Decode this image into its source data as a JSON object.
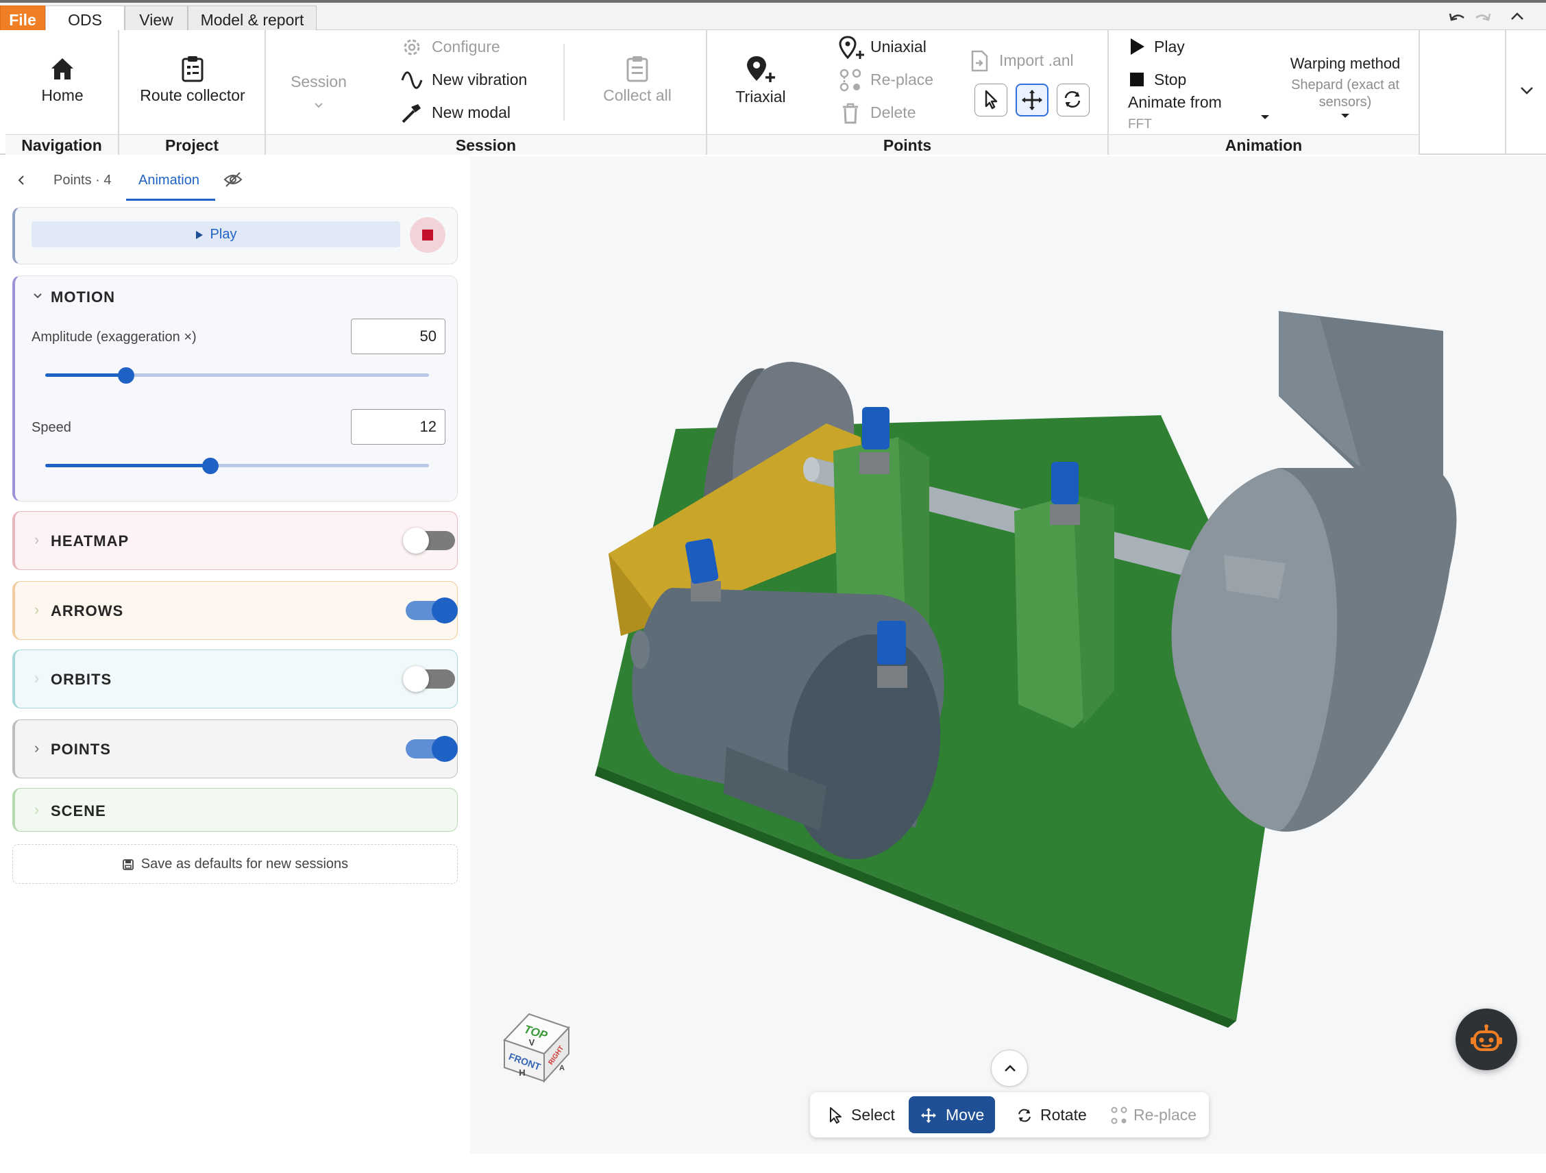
{
  "tabs": [
    {
      "label": "File"
    },
    {
      "label": "ODS"
    },
    {
      "label": "View"
    },
    {
      "label": "Model & report"
    }
  ],
  "ribbon": {
    "navigation": {
      "label": "Navigation",
      "home": "Home"
    },
    "project": {
      "label": "Project",
      "route_collector": "Route collector"
    },
    "session": {
      "label": "Session",
      "session_dropdown": "Session",
      "configure": "Configure",
      "new_vibration": "New vibration",
      "new_modal": "New modal",
      "collect_all": "Collect all"
    },
    "points": {
      "label": "Points",
      "triaxial": "Triaxial",
      "uniaxial": "Uniaxial",
      "replace": "Re-place",
      "delete": "Delete",
      "import_anl": "Import .anl"
    },
    "animation": {
      "label": "Animation",
      "play": "Play",
      "stop": "Stop",
      "animate_from": "Animate from",
      "animate_from_value": "FFT",
      "warping_method": "Warping method",
      "warping_value": "Shepard (exact at sensors)"
    }
  },
  "panel": {
    "tabs": {
      "points": "Points · 4",
      "animation": "Animation"
    },
    "play": "Play",
    "motion": {
      "title": "MOTION",
      "amplitude_label": "Amplitude (exaggeration ×)",
      "amplitude_value": "50",
      "amplitude_slider": 0.21,
      "speed_label": "Speed",
      "speed_value": "12",
      "speed_slider": 0.43
    },
    "sections": [
      {
        "title": "HEATMAP",
        "enabled": false,
        "color": "#e7b8bd",
        "bg": "#fdf3f4"
      },
      {
        "title": "ARROWS",
        "enabled": true,
        "color": "#f0cc9e",
        "bg": "#fef7ef"
      },
      {
        "title": "ORBITS",
        "enabled": false,
        "color": "#a7d8dc",
        "bg": "#f1f9fa"
      },
      {
        "title": "POINTS",
        "enabled": true,
        "color": "#bdbdbd",
        "bg": "#f4f4f4"
      },
      {
        "title": "SCENE",
        "color": "#b7d9b2",
        "bg": "#f2f9f1"
      }
    ],
    "save_defaults": "Save as defaults for new sessions"
  },
  "viewcube": {
    "top": "TOP",
    "top_sub": "V",
    "front": "FRONT",
    "front_sub": "H",
    "right": "RIGHT",
    "right_sub": "A"
  },
  "bottom_toolbar": {
    "select": "Select",
    "move": "Move",
    "rotate": "Rotate",
    "replace": "Re-place"
  },
  "colors": {
    "accent": "#1f62c6",
    "file_tab": "#f07e24",
    "base_plate": "#2e7d32",
    "motor": "#5d6c76",
    "bearing_blocks": "#4e9a4b",
    "coupling_box": "#c9a62a",
    "sensors": "#1a5dbe"
  }
}
